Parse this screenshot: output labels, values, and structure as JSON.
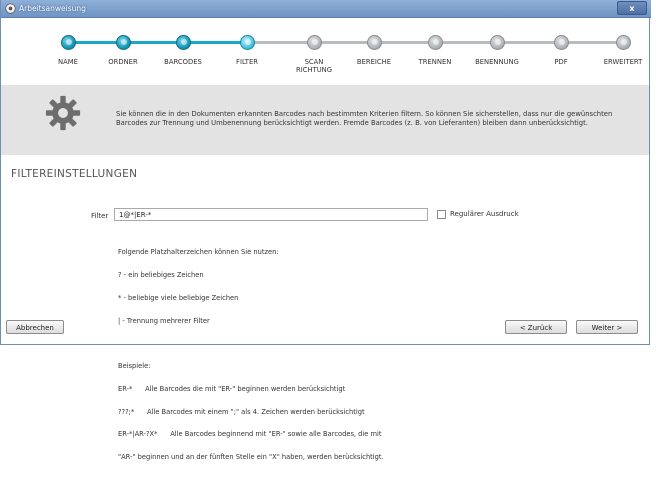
{
  "window": {
    "title": "Arbeitsanweisung",
    "close_label": "x"
  },
  "steps": [
    {
      "label": "NAME",
      "state": "done"
    },
    {
      "label": "ORDNER",
      "state": "done"
    },
    {
      "label": "BARCODES",
      "state": "done"
    },
    {
      "label": "FILTER",
      "state": "current"
    },
    {
      "label": "SCAN\nRICHTUNG",
      "state": "todo"
    },
    {
      "label": "BEREICHE",
      "state": "todo"
    },
    {
      "label": "TRENNEN",
      "state": "todo"
    },
    {
      "label": "BENENNUNG",
      "state": "todo"
    },
    {
      "label": "PDF",
      "state": "todo"
    },
    {
      "label": "ERWEITERT",
      "state": "todo"
    }
  ],
  "info": {
    "text": "Sie können die in den Dokumenten erkannten Barcodes nach bestimmten Kriterien filtern. So können Sie sicherstellen, dass nur die gewünschten Barcodes zur Trennung und Umbenennung berücksichtigt werden. Fremde Barcodes (z. B. von Lieferanten) bleiben dann unberücksichtigt.",
    "icon": "gear-icon"
  },
  "section_title": "FILTEREINSTELLUNGEN",
  "filter": {
    "label": "Filter",
    "value": "1@*|ER-*",
    "regex_label": "Regulärer Ausdruck",
    "regex_checked": false
  },
  "help": {
    "lines": [
      "Folgende Platzhalterzeichen können Sie nutzen:",
      "? - ein beliebiges Zeichen",
      "* - beliebige viele beliebige Zeichen",
      "| - Trennung mehrerer Filter",
      "",
      "Beispiele:",
      "ER-*      Alle Barcodes die mit \"ER-\" beginnen werden berücksichtigt",
      "???;*      Alle Barcodes mit einem \";\" als 4. Zeichen werden berücksichtigt",
      "ER-*|AR-?X*      Alle Barcodes beginnend mit \"ER-\" sowie alle Barcodes, die mit",
      "\"AR-\" beginnen und an der fünften Stelle ein \"X\" haben, werden berücksichtigt."
    ]
  },
  "buttons": {
    "cancel": "Abbrechen",
    "back": "< Zurück",
    "next": "Weiter >"
  },
  "colors": {
    "accent": "#1aa9c4",
    "inactive": "#b9bcbf",
    "titlebar": "#7a9dcc"
  }
}
